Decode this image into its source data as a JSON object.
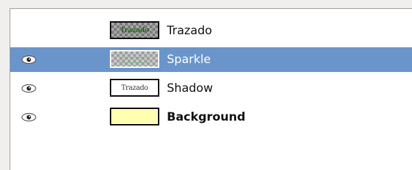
{
  "layers_panel": {
    "layers": [
      {
        "name": "Trazado",
        "visible": false,
        "selected": false,
        "thumbnail": "text-layer-thumbnail",
        "thumb_text": "Trazado",
        "bold": false
      },
      {
        "name": "Sparkle",
        "visible": true,
        "selected": true,
        "thumbnail": "sparkle-layer-thumbnail",
        "thumb_text": "",
        "bold": false
      },
      {
        "name": "Shadow",
        "visible": true,
        "selected": false,
        "thumbnail": "shadow-layer-thumbnail",
        "thumb_text": "Trazado",
        "bold": false
      },
      {
        "name": "Background",
        "visible": true,
        "selected": false,
        "thumbnail": "background-layer-thumbnail",
        "thumb_text": "",
        "bold": true
      }
    ],
    "colors": {
      "selection": "#6a95cb",
      "background_fill": "#ffffb0",
      "thumbnail_text": "#2a6a1f"
    },
    "icons": {
      "visibility": "eye-icon"
    }
  }
}
